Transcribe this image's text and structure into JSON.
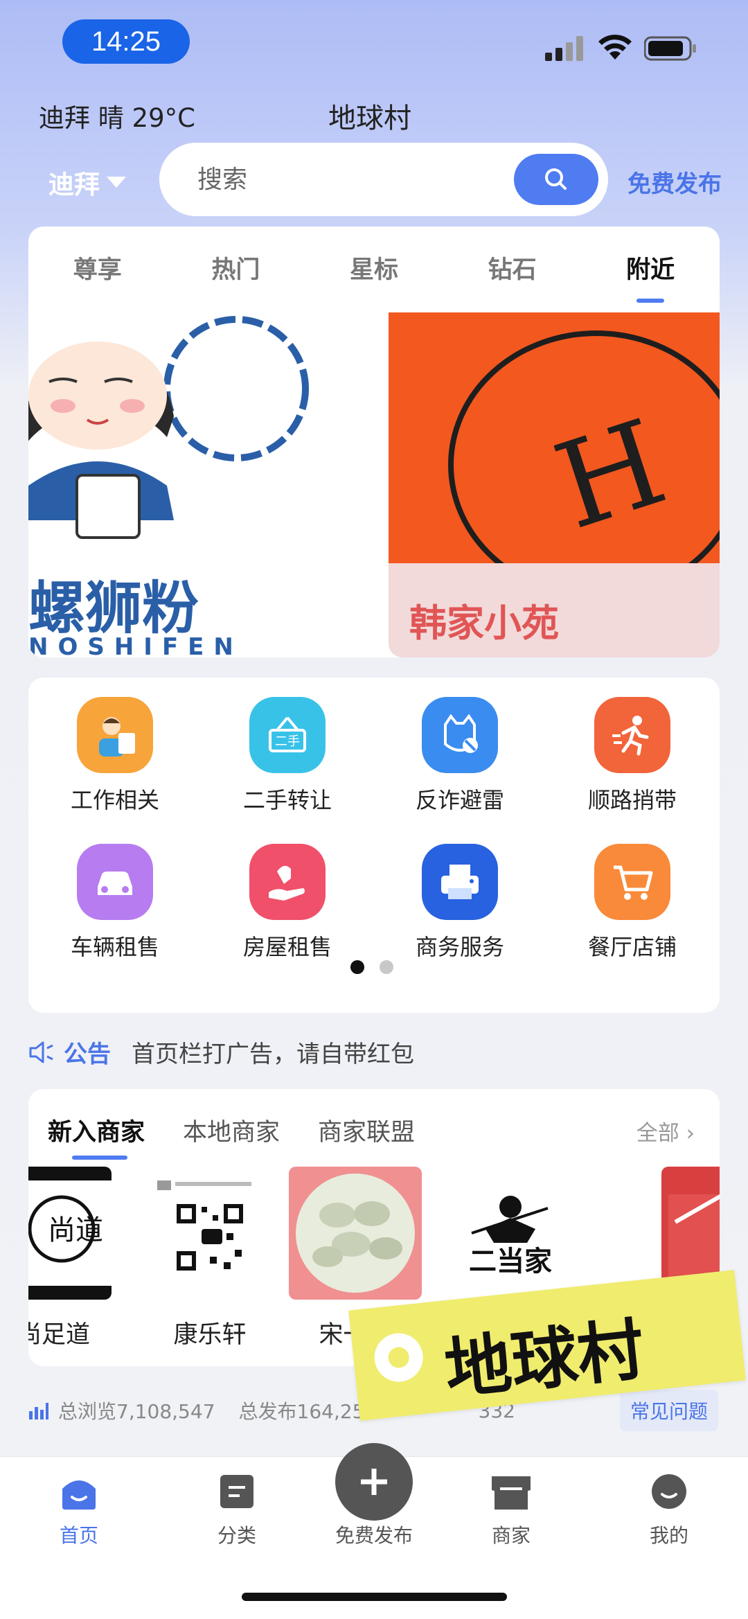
{
  "status_bar": {
    "time": "14:25"
  },
  "header": {
    "weather": "迪拜 晴 29°C",
    "title": "地球村",
    "city": "迪拜",
    "search_placeholder": "搜索",
    "publish_link": "免费发布"
  },
  "tabs": [
    "尊享",
    "热门",
    "星标",
    "钻石",
    "附近"
  ],
  "banner": {
    "left_brand_cn": "螺狮粉",
    "left_brand_en": "NOSHIFEN",
    "right_caption": "韩家小苑"
  },
  "categories": [
    {
      "label": "工作相关",
      "icon": "worker-icon",
      "color": "#f7a43a"
    },
    {
      "label": "二手转让",
      "icon": "secondhand-icon",
      "color": "#39c2e8"
    },
    {
      "label": "反诈避雷",
      "icon": "anti-fraud-icon",
      "color": "#3a8cf0"
    },
    {
      "label": "顺路捎带",
      "icon": "runner-icon",
      "color": "#f2643a"
    },
    {
      "label": "车辆租售",
      "icon": "car-icon",
      "color": "#b67cf0"
    },
    {
      "label": "房屋租售",
      "icon": "house-hand-icon",
      "color": "#f0506a"
    },
    {
      "label": "商务服务",
      "icon": "printer-icon",
      "color": "#2862e0"
    },
    {
      "label": "餐厅店铺",
      "icon": "cart-icon",
      "color": "#f88a3a"
    }
  ],
  "notice": {
    "tag": "公告",
    "text": "首页栏打广告，请自带红包"
  },
  "merchants": {
    "tabs": [
      "新入商家",
      "本地商家",
      "商家联盟"
    ],
    "all_link": "全部",
    "items": [
      {
        "name": "尚足道",
        "visible_name": "尚足道"
      },
      {
        "name": "康乐轩"
      },
      {
        "name": "宋一饺"
      },
      {
        "name": "",
        "logo_text": "二当家"
      },
      {
        "name": ""
      }
    ]
  },
  "stats": {
    "views": "总浏览7,108,547",
    "posts": "总发布164,25",
    "tail": "332",
    "faq": "常见问题"
  },
  "sticker_text": "地球村",
  "bottom_nav": [
    {
      "label": "首页",
      "icon": "home-icon"
    },
    {
      "label": "分类",
      "icon": "category-icon"
    },
    {
      "label": "免费发布",
      "icon": "plus-icon"
    },
    {
      "label": "商家",
      "icon": "shop-icon"
    },
    {
      "label": "我的",
      "icon": "user-icon"
    }
  ],
  "colors": {
    "accent": "#4f7cf0",
    "time_pill": "#1a64e8"
  }
}
